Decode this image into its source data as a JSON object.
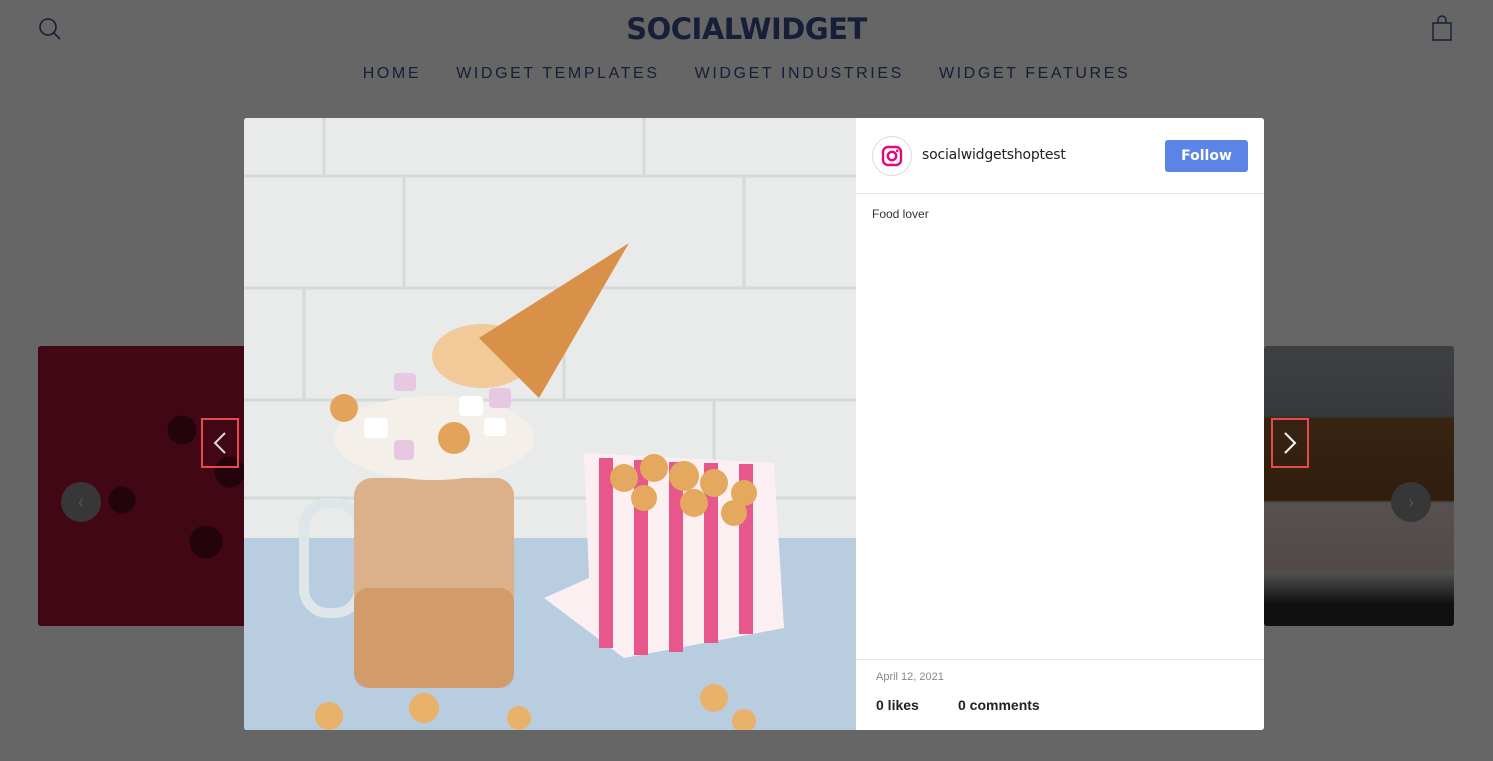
{
  "header": {
    "logo": "SOCIALWIDGET",
    "search_icon": "search-icon",
    "cart_icon": "shopping-bag-icon",
    "nav": [
      "HOME",
      "WIDGET TEMPLATES",
      "WIDGET INDUSTRIES",
      "WIDGET FEATURES"
    ]
  },
  "carousel": {
    "prev_glyph": "‹",
    "next_glyph": "›"
  },
  "modal": {
    "photo_alt": "Freakshake with ice cream cone, marshmallows and a striped bag of caramel popcorn",
    "account": {
      "icon": "instagram-icon",
      "username": "socialwidgetshoptest"
    },
    "follow_label": "Follow",
    "caption": "Food lover",
    "date": "April 12, 2021",
    "likes": "0 likes",
    "comments": "0 comments",
    "colors": {
      "follow": "#5b84e6",
      "instagram": "#e4087a",
      "highlight": "#e84a4a"
    }
  }
}
